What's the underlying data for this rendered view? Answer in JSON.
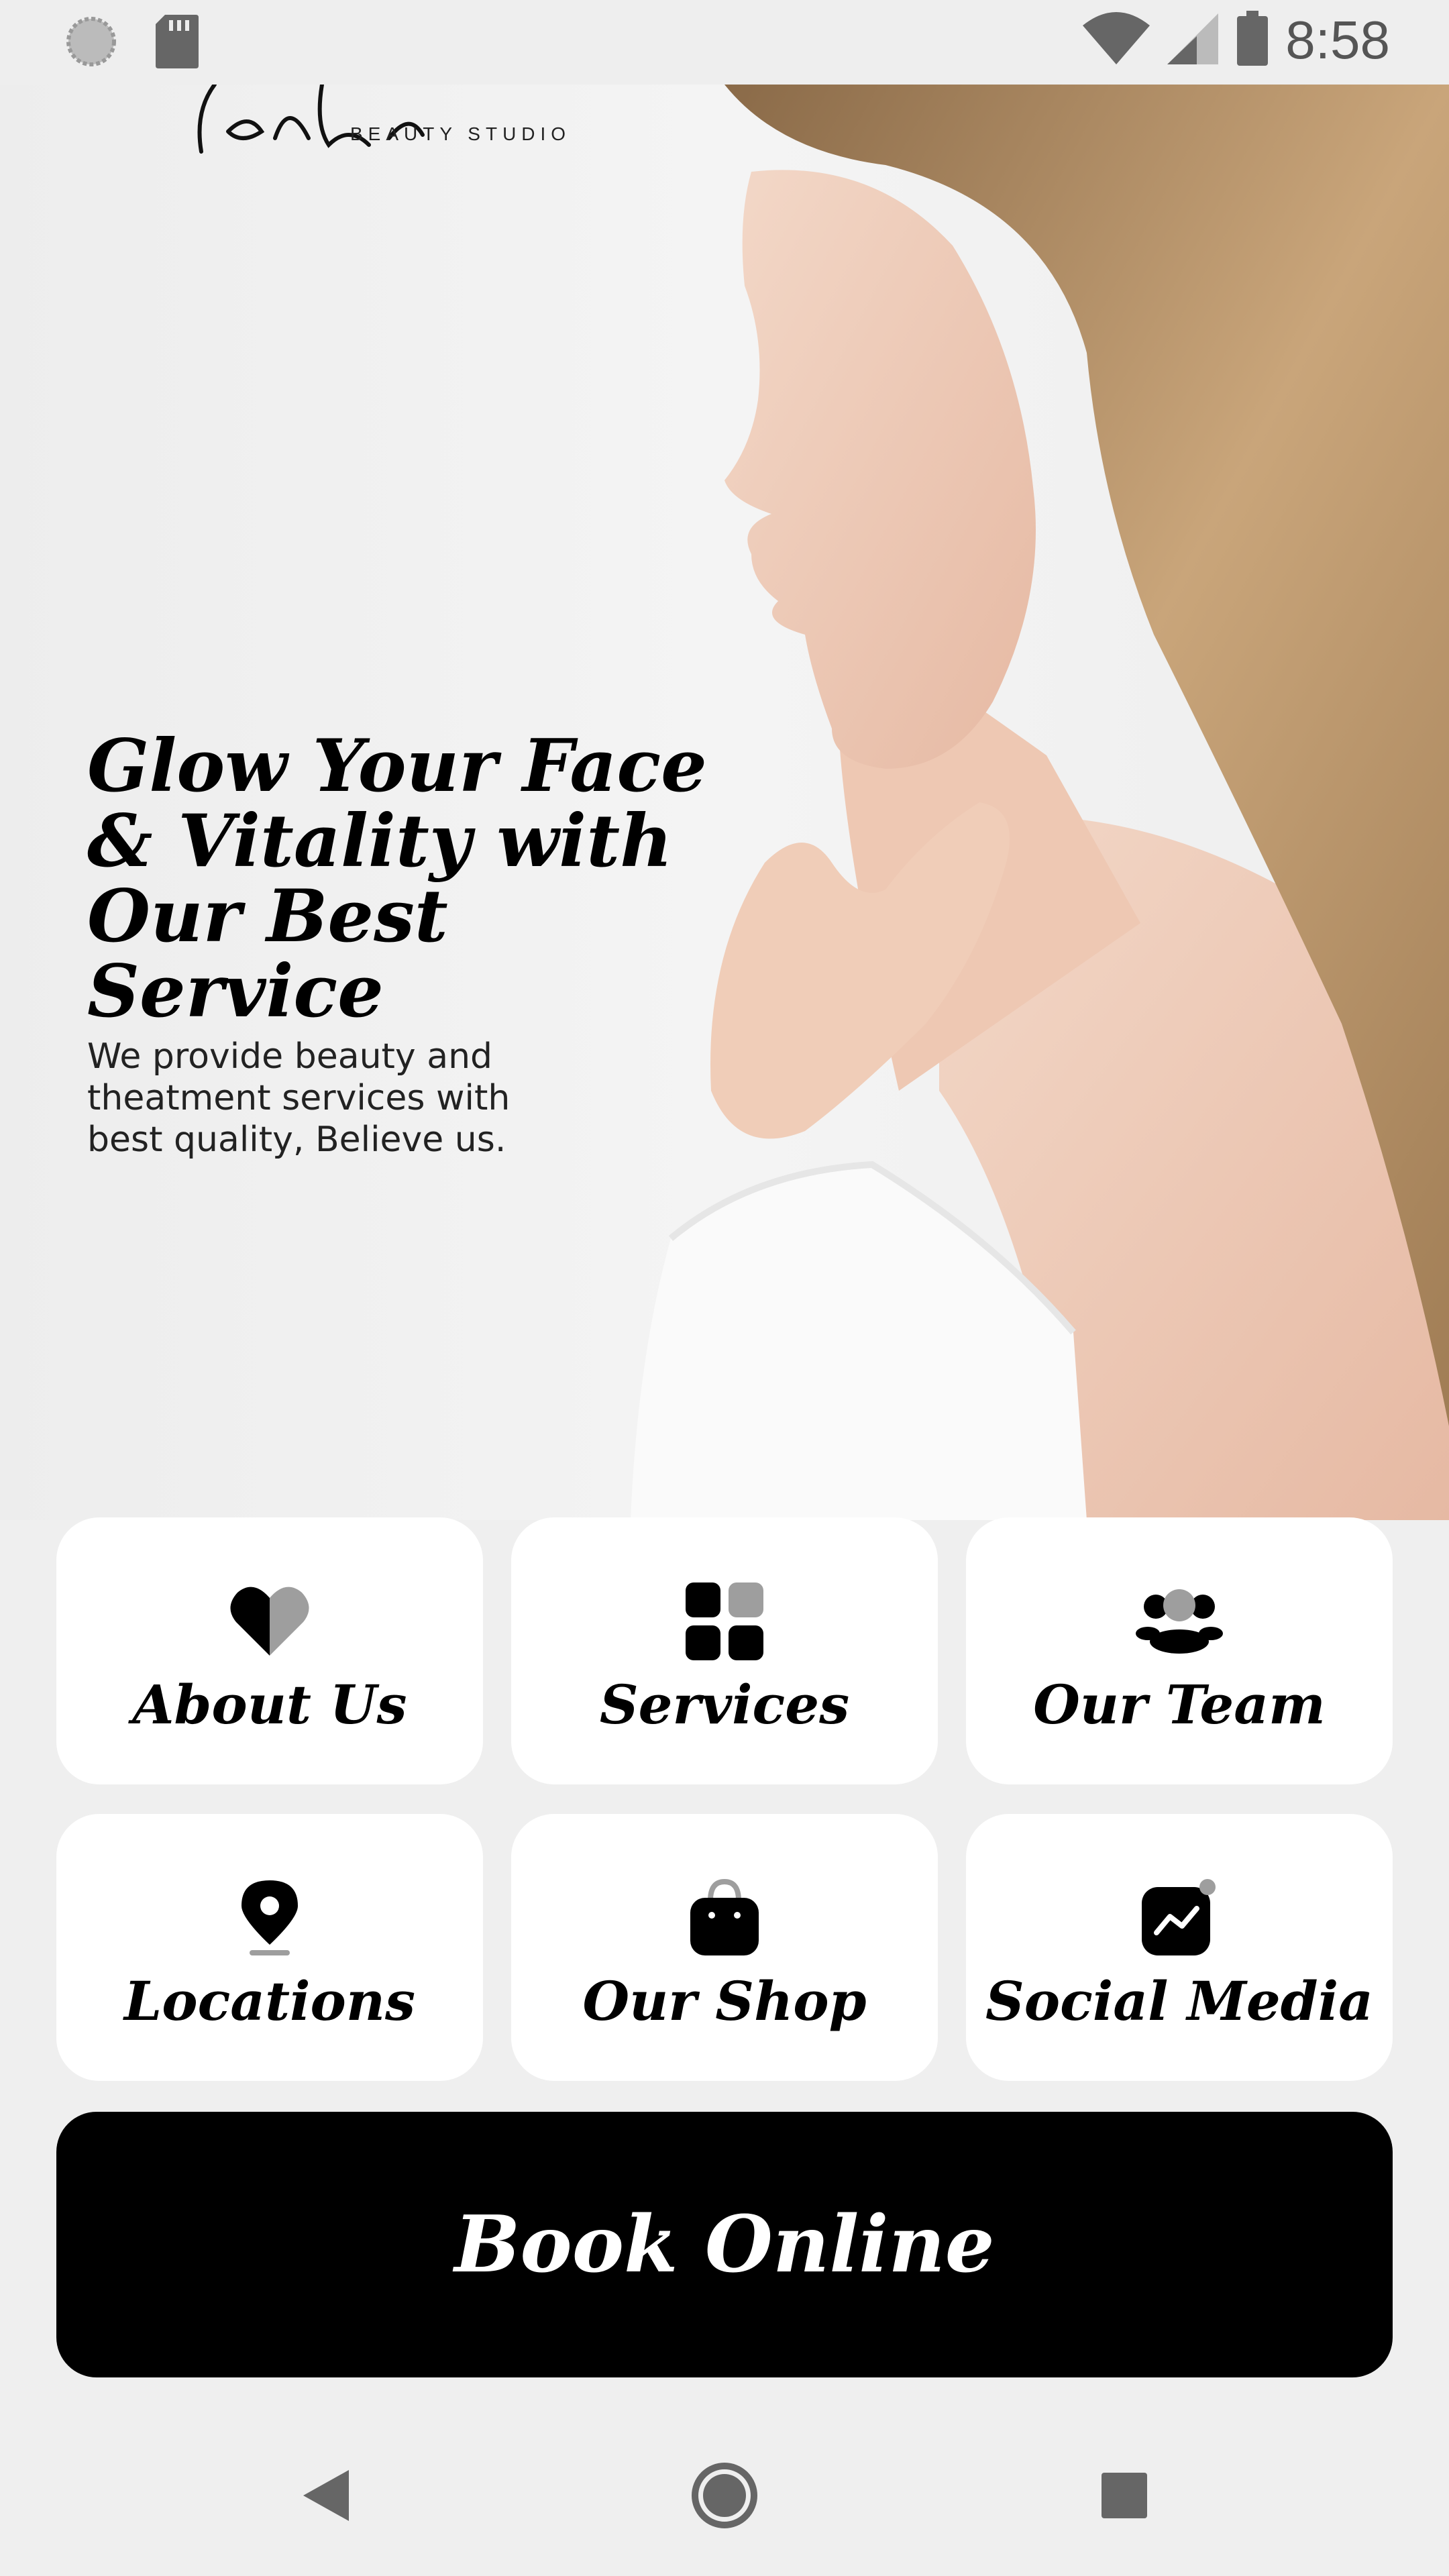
{
  "status_bar": {
    "time": "8:58",
    "icons": [
      "sync-icon",
      "sd-card-icon",
      "wifi-icon",
      "cell-signal-icon",
      "battery-icon"
    ]
  },
  "hero": {
    "logo_sub": "BEAUTY STUDIO",
    "headline": [
      "Glow Your Face",
      "& Vitality with",
      "Our Best Service"
    ],
    "subtext": [
      "We provide beauty and",
      "theatment services with",
      "best quality, Believe us."
    ]
  },
  "tiles": [
    {
      "label": "About Us",
      "icon": "heart-icon"
    },
    {
      "label": "Services",
      "icon": "grid-icon"
    },
    {
      "label": "Our Team",
      "icon": "team-icon"
    },
    {
      "label": "Locations",
      "icon": "location-pin-icon"
    },
    {
      "label": "Our Shop",
      "icon": "shopping-bag-icon"
    },
    {
      "label": "Social Media",
      "icon": "social-activity-icon"
    }
  ],
  "book_button": {
    "label": "Book Online"
  },
  "nav": {
    "icons": [
      "back-icon",
      "home-icon",
      "recents-icon"
    ]
  },
  "colors": {
    "accent": "#000000",
    "tile_bg": "#ffffff",
    "icon_secondary": "#9e9e9e",
    "background": "#efefef"
  }
}
